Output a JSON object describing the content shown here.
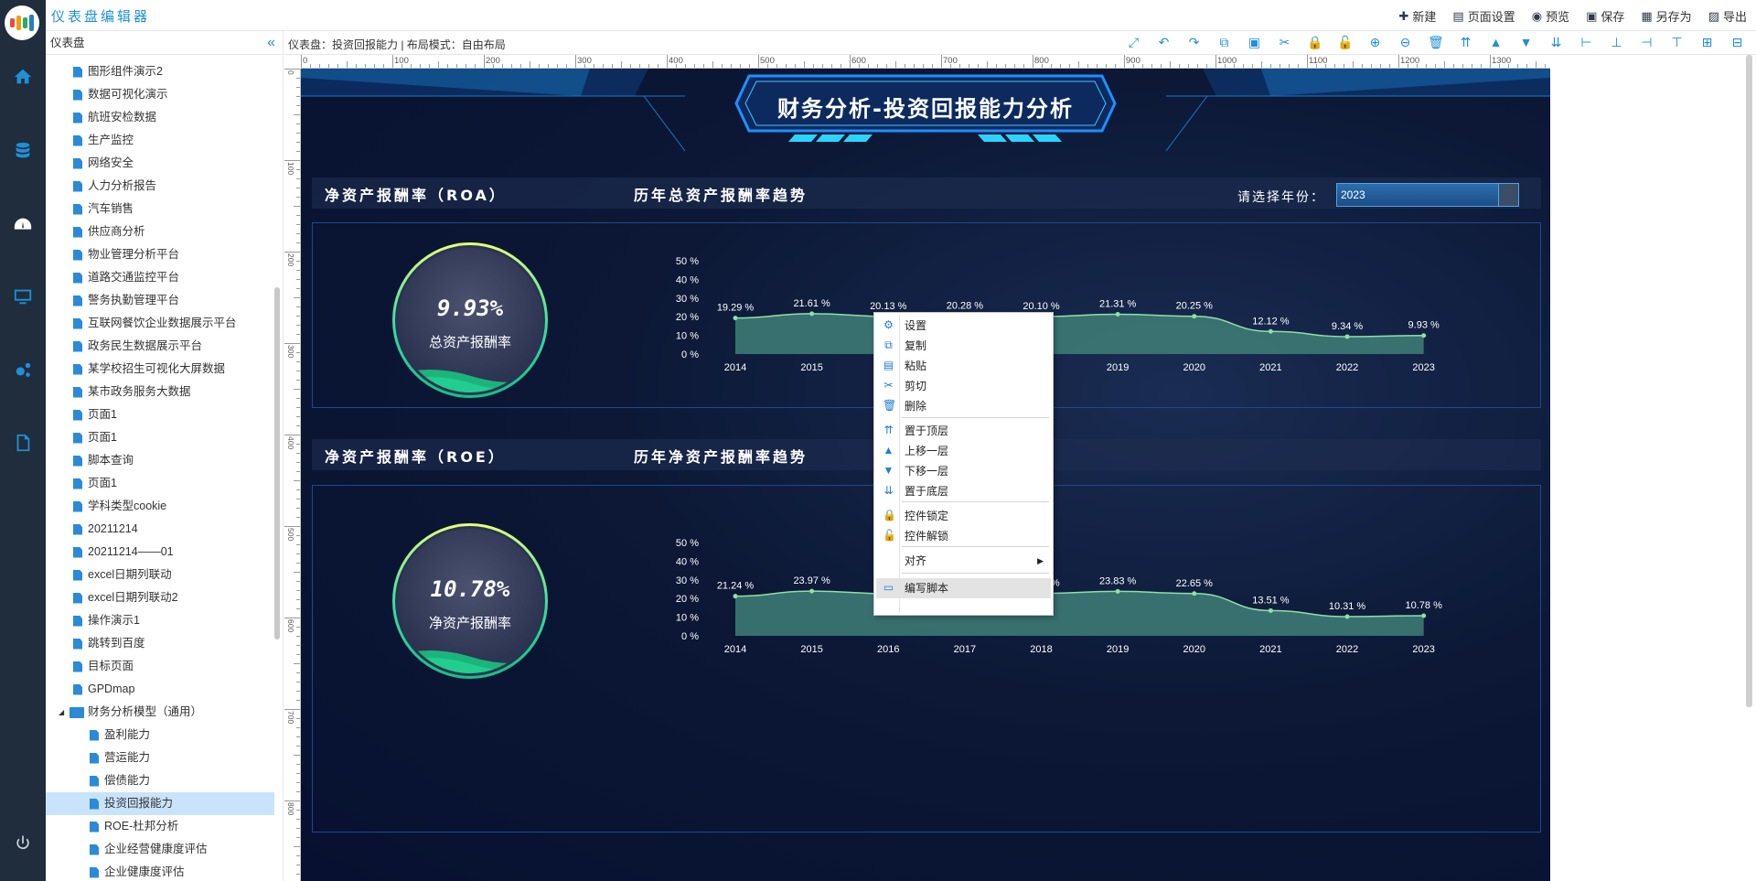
{
  "app": {
    "title": "仪表盘编辑器"
  },
  "topbar": {
    "actions": [
      {
        "label": "新建",
        "icon": "new-icon"
      },
      {
        "label": "页面设置",
        "icon": "page-settings-icon"
      },
      {
        "label": "预览",
        "icon": "eye-icon"
      },
      {
        "label": "保存",
        "icon": "save-icon"
      },
      {
        "label": "另存为",
        "icon": "save-as-icon"
      },
      {
        "label": "导出",
        "icon": "export-icon"
      }
    ]
  },
  "sidebar": {
    "header": "仪表盘",
    "collapse_icon": "double-chevron-left-icon",
    "items": [
      {
        "label": "图形组件演示2",
        "level": 1
      },
      {
        "label": "数据可视化演示",
        "level": 1
      },
      {
        "label": "航班安检数据",
        "level": 1
      },
      {
        "label": "生产监控",
        "level": 1
      },
      {
        "label": "网络安全",
        "level": 1
      },
      {
        "label": "人力分析报告",
        "level": 1
      },
      {
        "label": "汽车销售",
        "level": 1
      },
      {
        "label": "供应商分析",
        "level": 1
      },
      {
        "label": "物业管理分析平台",
        "level": 1
      },
      {
        "label": "道路交通监控平台",
        "level": 1
      },
      {
        "label": "警务执勤管理平台",
        "level": 1
      },
      {
        "label": "互联网餐饮企业数据展示平台",
        "level": 1
      },
      {
        "label": "政务民生数据展示平台",
        "level": 1
      },
      {
        "label": "某学校招生可视化大屏数据",
        "level": 1
      },
      {
        "label": "某市政务服务大数据",
        "level": 1
      },
      {
        "label": "页面1",
        "level": 1
      },
      {
        "label": "页面1",
        "level": 1
      },
      {
        "label": "脚本查询",
        "level": 1
      },
      {
        "label": "页面1",
        "level": 1
      },
      {
        "label": "学科类型cookie",
        "level": 1
      },
      {
        "label": "20211214",
        "level": 1
      },
      {
        "label": "20211214——01",
        "level": 1
      },
      {
        "label": "excel日期列联动",
        "level": 1
      },
      {
        "label": "excel日期列联动2",
        "level": 1
      },
      {
        "label": "操作演示1",
        "level": 1
      },
      {
        "label": "跳转到百度",
        "level": 1
      },
      {
        "label": "目标页面",
        "level": 1
      },
      {
        "label": "GPDmap",
        "level": 1
      },
      {
        "label": "财务分析模型（通用）",
        "level": 0,
        "folder": true
      },
      {
        "label": "盈利能力",
        "level": 2
      },
      {
        "label": "营运能力",
        "level": 2
      },
      {
        "label": "偿债能力",
        "level": 2
      },
      {
        "label": "投资回报能力",
        "level": 2,
        "selected": true
      },
      {
        "label": "ROE-杜邦分析",
        "level": 2
      },
      {
        "label": "企业经营健康度评估",
        "level": 2
      },
      {
        "label": "企业健康度评估",
        "level": 2
      }
    ]
  },
  "canvasbar": {
    "breadcrumb": "仪表盘：投资回报能力 | 布局模式：自由布局",
    "tools": [
      "link-icon",
      "undo-icon",
      "redo-icon",
      "copy-icon",
      "paste-icon",
      "cut-icon",
      "lock-icon",
      "unlock-icon",
      "zoom-in-icon",
      "zoom-out-icon",
      "delete-icon",
      "bring-to-front-icon",
      "move-up-icon",
      "move-down-icon",
      "send-to-back-icon",
      "align-left-icon",
      "align-center-icon",
      "align-right-icon",
      "align-top-icon",
      "align-middle-icon",
      "align-bottom-icon"
    ]
  },
  "rulers": {
    "top": [
      "0",
      "100",
      "200",
      "300",
      "400",
      "500",
      "600",
      "700",
      "800",
      "900",
      "1000",
      "1100",
      "1200",
      "1300"
    ],
    "left": [
      "0",
      "100",
      "200",
      "300",
      "400",
      "500",
      "600",
      "700",
      "800"
    ]
  },
  "dashboard": {
    "title": "财务分析-投资回报能力分析",
    "year_label": "请选择年份：",
    "year_value": "2023",
    "roa": {
      "section_title": "净资产报酬率（ROA）",
      "trend_title": "历年总资产报酬率趋势",
      "gauge_value": "9.93%",
      "gauge_label": "总资产报酬率"
    },
    "roe": {
      "section_title": "净资产报酬率（ROE）",
      "trend_title": "历年净资产报酬率趋势",
      "gauge_value": "10.78%",
      "gauge_label": "净资产报酬率"
    },
    "colors": {
      "accent": "#1e90d6",
      "area_fill": "#3f7f78",
      "line": "#8fe0a8",
      "bg": "#0c1836"
    }
  },
  "chart_data": [
    {
      "type": "area",
      "title": "历年总资产报酬率趋势",
      "categories": [
        "2014",
        "2015",
        "2016",
        "2017",
        "2018",
        "2019",
        "2020",
        "2021",
        "2022",
        "2023"
      ],
      "values": [
        19.29,
        21.61,
        20.13,
        20.28,
        20.1,
        21.31,
        20.25,
        12.12,
        9.34,
        9.93
      ],
      "labels": [
        "19.29 %",
        "21.61 %",
        "20.13 %",
        "20.28 %",
        "20.10 %",
        "21.31 %",
        "20.25 %",
        "12.12 %",
        "9.34 %",
        "9.93 %"
      ],
      "y_ticks": [
        "50 %",
        "40 %",
        "30 %",
        "20 %",
        "10 %",
        "0 %"
      ],
      "ylim": [
        0,
        50
      ]
    },
    {
      "type": "area",
      "title": "历年净资产报酬率趋势",
      "categories": [
        "2014",
        "2015",
        "2016",
        "2017",
        "2018",
        "2019",
        "2020",
        "2021",
        "2022",
        "2023"
      ],
      "values": [
        21.24,
        23.97,
        22.6,
        22.7,
        22.75,
        23.83,
        22.65,
        13.51,
        10.31,
        10.78
      ],
      "labels": [
        "21.24 %",
        "23.97 %",
        "",
        "",
        "22.75 %",
        "23.83 %",
        "22.65 %",
        "13.51 %",
        "10.31 %",
        "10.78 %"
      ],
      "y_ticks": [
        "50 %",
        "40 %",
        "30 %",
        "20 %",
        "10 %",
        "0 %"
      ],
      "ylim": [
        0,
        50
      ]
    }
  ],
  "context_menu": {
    "items": [
      {
        "label": "设置",
        "icon": "settings-icon"
      },
      {
        "label": "复制",
        "icon": "copy-icon"
      },
      {
        "label": "粘贴",
        "icon": "paste-icon"
      },
      {
        "label": "剪切",
        "icon": "cut-icon"
      },
      {
        "label": "删除",
        "icon": "delete-icon"
      },
      {
        "label": "置于顶层",
        "icon": "bring-to-front-icon"
      },
      {
        "label": "上移一层",
        "icon": "move-up-icon"
      },
      {
        "label": "下移一层",
        "icon": "move-down-icon"
      },
      {
        "label": "置于底层",
        "icon": "send-to-back-icon"
      },
      {
        "label": "控件锁定",
        "icon": "lock-icon"
      },
      {
        "label": "控件解锁",
        "icon": "unlock-icon"
      },
      {
        "label": "对齐",
        "icon": "",
        "submenu": true
      },
      {
        "label": "编写脚本",
        "icon": "script-icon",
        "hover": true
      }
    ]
  }
}
